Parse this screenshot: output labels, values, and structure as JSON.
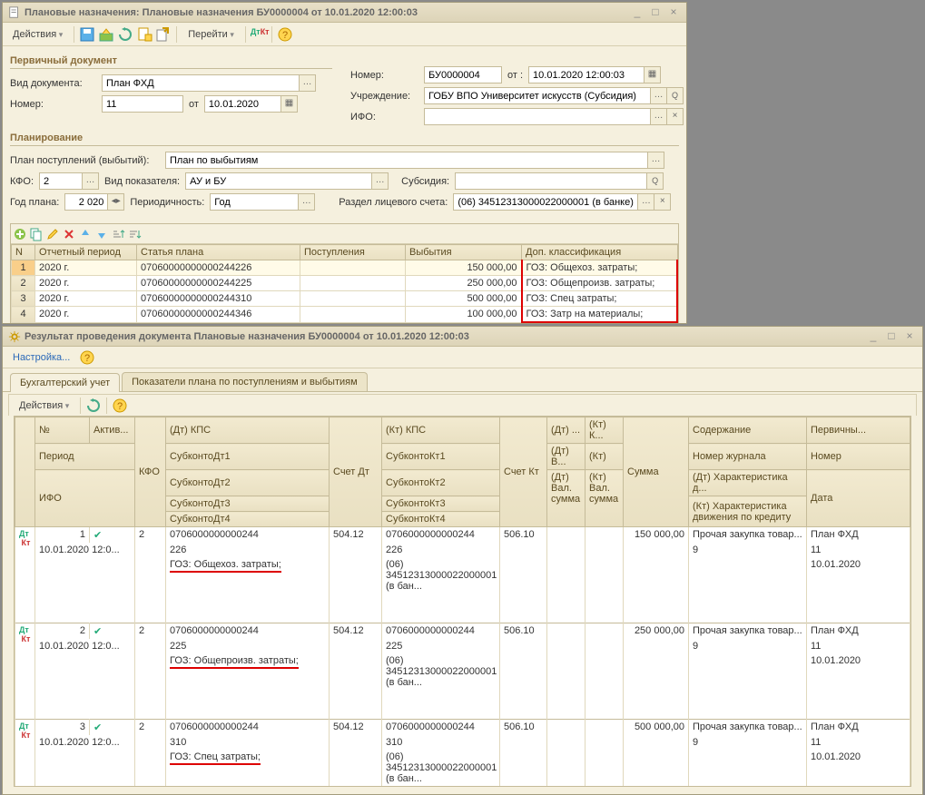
{
  "win1": {
    "title": "Плановые назначения: Плановые назначения БУ0000004 от 10.01.2020 12:00:03",
    "toolbar": {
      "actions": "Действия",
      "go": "Перейти"
    },
    "section1": "Первичный документ",
    "doc_type_lbl": "Вид документа:",
    "doc_type": "План ФХД",
    "orig_num_lbl": "Номер:",
    "orig_num": "11",
    "from_lbl": "от",
    "orig_date": "10.01.2020",
    "num_lbl": "Номер:",
    "num": "БУ0000004",
    "from2_lbl": "от :",
    "date": "10.01.2020 12:00:03",
    "org_lbl": "Учреждение:",
    "org": "ГОБУ ВПО Университет искусств (Субсидия)",
    "ifo_lbl": "ИФО:",
    "ifo": "",
    "section2": "Планирование",
    "plan_flow_lbl": "План поступлений (выбытий):",
    "plan_flow": "План по выбытиям",
    "kfo_lbl": "КФО:",
    "kfo": "2",
    "ind_lbl": "Вид показателя:",
    "ind": "АУ и БУ",
    "subs_lbl": "Субсидия:",
    "subs": "",
    "year_lbl": "Год плана:",
    "year": "2 020",
    "period_lbl": "Периодичность:",
    "period": "Год",
    "ls_lbl": "Раздел лицевого счета:",
    "ls": "(06) 34512313000022000001 (в банке)",
    "cols": {
      "n": "N",
      "period": "Отчетный период",
      "code": "Статья плана",
      "in": "Поступления",
      "out": "Выбытия",
      "extra": "Доп. классификация"
    },
    "rows": [
      {
        "n": "1",
        "p": "2020 г.",
        "c": "07060000000000244226",
        "o": "150 000,00",
        "e": "ГОЗ: Общехоз. затраты;"
      },
      {
        "n": "2",
        "p": "2020 г.",
        "c": "07060000000000244225",
        "o": "250 000,00",
        "e": "ГОЗ: Общепроизв. затраты;"
      },
      {
        "n": "3",
        "p": "2020 г.",
        "c": "07060000000000244310",
        "o": "500 000,00",
        "e": "ГОЗ: Спец затраты;"
      },
      {
        "n": "4",
        "p": "2020 г.",
        "c": "07060000000000244346",
        "o": "100 000,00",
        "e": "ГОЗ: Затр на материалы;"
      }
    ]
  },
  "win2": {
    "title": "Результат проведения документа Плановые назначения БУ0000004 от 10.01.2020 12:00:03",
    "settings": "Настройка...",
    "tab1": "Бухгалтерский учет",
    "tab2": "Показатели плана по поступлениям и выбытиям",
    "actions": "Действия",
    "hdr": {
      "n": "№",
      "act": "Актив...",
      "kfo": "КФО",
      "dtkps": "(Дт) КПС",
      "accdt": "Счет Дт",
      "ktkps": "(Кт) КПС",
      "acckt": "Счет Кт",
      "dtk": "(Дт) ...",
      "ktk": "(Кт) К...",
      "sum": "Сумма",
      "content": "Содержание",
      "primary": "Первичны...",
      "period": "Период",
      "sub1": "СубконтоДт1",
      "sub2": "СубконтоДт2",
      "sub3": "СубконтоДт3",
      "sub4": "СубконтоДт4",
      "ksub1": "СубконтоКт1",
      "ksub2": "СубконтоКт2",
      "ksub3": "СубконтоКт3",
      "ksub4": "СубконтоКт4",
      "dtv": "(Дт)",
      "ktv": "(Кт)",
      "dval": "Вал. сумма",
      "kval": "Вал. сумма",
      "dtvv": "(Дт) В...",
      "journal": "Номер журнала",
      "numh": "Номер",
      "dtchar": "(Дт) Характеристика д...",
      "date": "Дата",
      "ktchar": "(Кт) Характеристика движения по кредиту",
      "ifo": "ИФО"
    },
    "rows": [
      {
        "n": "1",
        "date": "10.01.2020 12:0...",
        "kfo": "2",
        "dtkps1": "0706000000000244",
        "dtkps2": "226",
        "dtkps3": "ГОЗ: Общехоз. затраты;",
        "accdt": "504.12",
        "ktkps1": "0706000000000244",
        "ktkps2": "226",
        "ktkps3": "(06) 34512313000022000001 (в бан...",
        "acckt": "506.10",
        "sum": "150 000,00",
        "content": "Прочая закупка товар...",
        "journal": "9",
        "prim1": "План ФХД",
        "prim2": "11",
        "prim3": "10.01.2020"
      },
      {
        "n": "2",
        "date": "10.01.2020 12:0...",
        "kfo": "2",
        "dtkps1": "0706000000000244",
        "dtkps2": "225",
        "dtkps3": "ГОЗ: Общепроизв. затраты;",
        "accdt": "504.12",
        "ktkps1": "0706000000000244",
        "ktkps2": "225",
        "ktkps3": "(06) 34512313000022000001 (в бан...",
        "acckt": "506.10",
        "sum": "250 000,00",
        "content": "Прочая закупка товар...",
        "journal": "9",
        "prim1": "План ФХД",
        "prim2": "11",
        "prim3": "10.01.2020"
      },
      {
        "n": "3",
        "date": "10.01.2020 12:0...",
        "kfo": "2",
        "dtkps1": "0706000000000244",
        "dtkps2": "310",
        "dtkps3": "ГОЗ: Спец затраты;",
        "accdt": "504.12",
        "ktkps1": "0706000000000244",
        "ktkps2": "310",
        "ktkps3": "(06) 34512313000022000001 (в бан...",
        "acckt": "506.10",
        "sum": "500 000,00",
        "content": "Прочая закупка товар...",
        "journal": "9",
        "prim1": "План ФХД",
        "prim2": "11",
        "prim3": "10.01.2020"
      }
    ]
  }
}
